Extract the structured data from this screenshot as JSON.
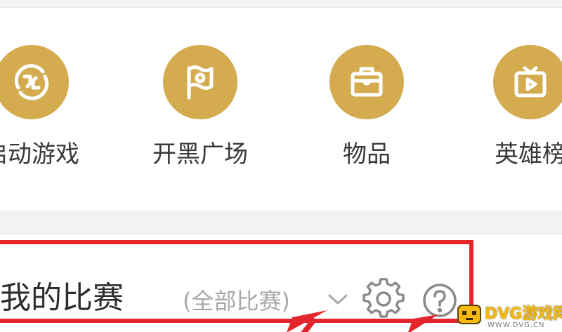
{
  "shortcuts": [
    {
      "label": "启动游戏",
      "icon": "launch-game-icon"
    },
    {
      "label": "开黑广场",
      "icon": "flag-icon"
    },
    {
      "label": "物品",
      "icon": "item-chest-icon"
    },
    {
      "label": "英雄榜",
      "icon": "tv-icon"
    }
  ],
  "matches": {
    "title": "我的比赛",
    "filter": "(全部比赛)",
    "filter_icon": "chevron-down-icon",
    "settings_icon": "gear-icon",
    "help_icon": "question-circle-icon"
  },
  "watermark": {
    "text": "DVG游戏网",
    "domain": "WWW.DVG.CN"
  },
  "colors": {
    "icon_circle": "#d4ab4f",
    "highlight": "#e3262c",
    "watermark": "#f5b90f"
  }
}
